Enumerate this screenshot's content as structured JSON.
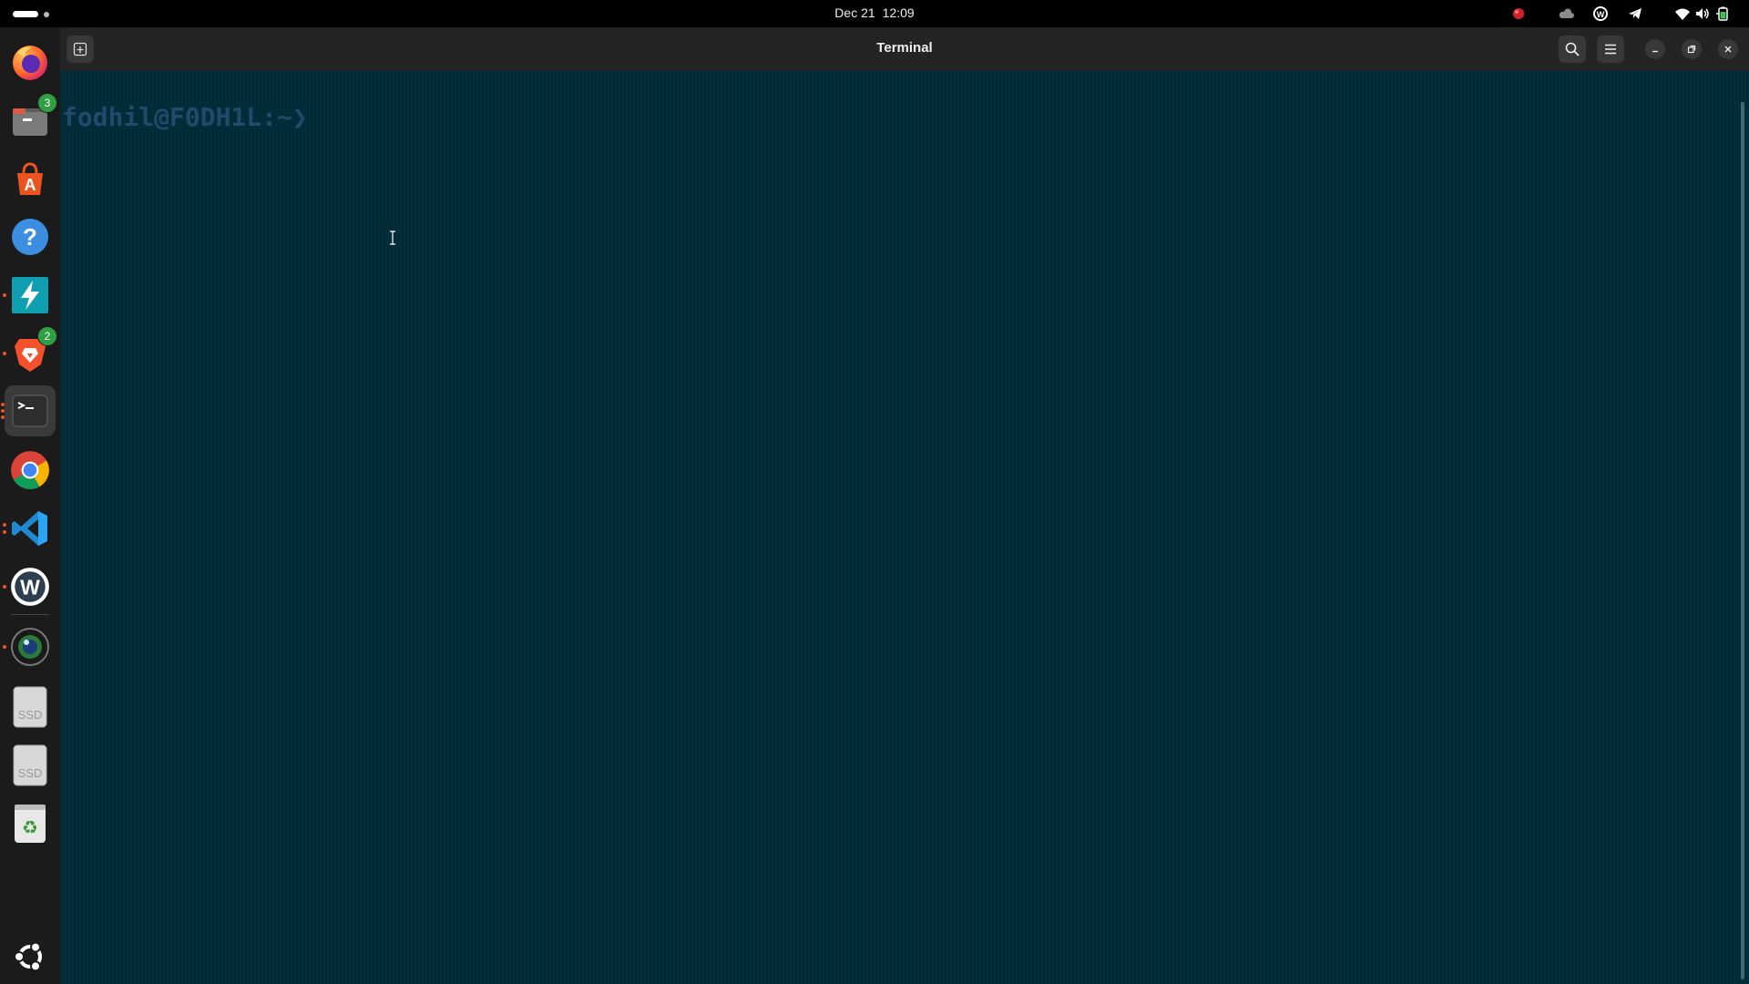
{
  "topbar": {
    "date": "Dec 21",
    "time": "12:09",
    "tray_icons": [
      "record-indicator-icon",
      "cloud-icon",
      "w-app-icon",
      "telegram-icon",
      "wifi-icon",
      "volume-icon",
      "battery-icon"
    ]
  },
  "dock": {
    "items": [
      {
        "name": "firefox",
        "icon": "firefox-icon"
      },
      {
        "name": "files",
        "icon": "files-icon",
        "badge": "3"
      },
      {
        "name": "app-center",
        "icon": "app-center-icon"
      },
      {
        "name": "help",
        "icon": "help-icon"
      },
      {
        "name": "flash",
        "icon": "lightning-icon"
      },
      {
        "name": "brave",
        "icon": "brave-icon",
        "badge": "2"
      },
      {
        "name": "terminal",
        "icon": "terminal-icon"
      },
      {
        "name": "chrome",
        "icon": "chrome-icon"
      },
      {
        "name": "vscode",
        "icon": "vscode-icon"
      },
      {
        "name": "w-app",
        "icon": "w-logo-icon"
      },
      {
        "name": "camera",
        "icon": "camera-lens-icon"
      },
      {
        "name": "ssd-1",
        "icon": "ssd-drive-icon",
        "label": "SSD"
      },
      {
        "name": "ssd-2",
        "icon": "ssd-drive-icon",
        "label": "SSD"
      },
      {
        "name": "trash",
        "icon": "trash-icon"
      },
      {
        "name": "show-apps",
        "icon": "ubuntu-logo-icon"
      }
    ],
    "badges": {
      "files": "3",
      "brave": "2"
    },
    "ssd_label": "SSD"
  },
  "window": {
    "title": "Terminal",
    "prompt": "fodhil@F0DH1L:~❯"
  },
  "colors": {
    "terminal_bg": "#012b37",
    "prompt": "#23496c",
    "badge": "#2ea043",
    "ubuntu_orange": "#e95420"
  }
}
